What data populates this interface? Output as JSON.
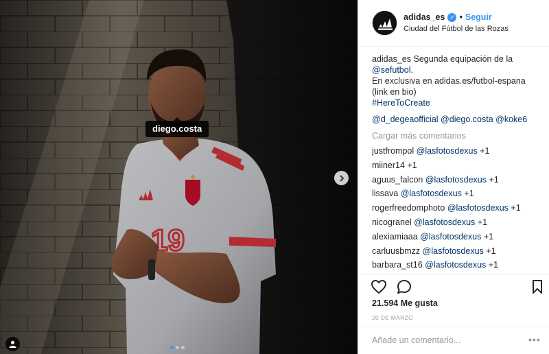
{
  "photo": {
    "tag": "diego.costa",
    "jersey_number": "19",
    "dots_count": 3,
    "dots_active_index": 0
  },
  "header": {
    "username": "adidas_es",
    "separator": "•",
    "follow_label": "Seguir",
    "location": "Ciudad del Fútbol de las Rozas"
  },
  "caption": {
    "username": "adidas_es",
    "text1": "Segunda equipación de la",
    "mention": "@sefutbol",
    "dot": ".",
    "line2": "En exclusiva en adidas.es/futbol-espana",
    "line3": "(link en bio)",
    "hashtag": "#HereToCreate"
  },
  "mentions": [
    "@d_degeaofficial",
    "@diego.costa",
    "@koke6"
  ],
  "load_more_label": "Cargar más comentarios",
  "comments": [
    {
      "user": "justfrompol",
      "mention": "@lasfotosdexus",
      "text": "+1"
    },
    {
      "user": "miiner14",
      "mention": "",
      "text": "+1"
    },
    {
      "user": "aguus_falcon",
      "mention": "@lasfotosdexus",
      "text": "+1"
    },
    {
      "user": "lissava",
      "mention": "@lasfotosdexus",
      "text": "+1"
    },
    {
      "user": "rogerfreedomphoto",
      "mention": "@lasfotosdexus",
      "text": "+1"
    },
    {
      "user": "nicogranel",
      "mention": "@lasfotosdexus",
      "text": "+1"
    },
    {
      "user": "alexiamiaaa",
      "mention": "@lasfotosdexus",
      "text": "+1"
    },
    {
      "user": "carluusbmzz",
      "mention": "@lasfotosdexus",
      "text": "+1"
    },
    {
      "user": "barbara_st16",
      "mention": "@lasfotosdexus",
      "text": "+1"
    }
  ],
  "likes": "21.594 Me gusta",
  "date": "20 DE MARZO",
  "comment_input": {
    "placeholder": "Añade un comentario..."
  },
  "more_label": "•••",
  "icons": {
    "like": "heart-icon",
    "comment": "comment-bubble-icon",
    "save": "bookmark-icon",
    "next": "chevron-right-icon",
    "user_tag": "person-icon",
    "verified": "verified-badge-icon"
  },
  "colors": {
    "link": "#003569",
    "follow": "#3897f0",
    "muted": "#999999",
    "text": "#262626"
  }
}
